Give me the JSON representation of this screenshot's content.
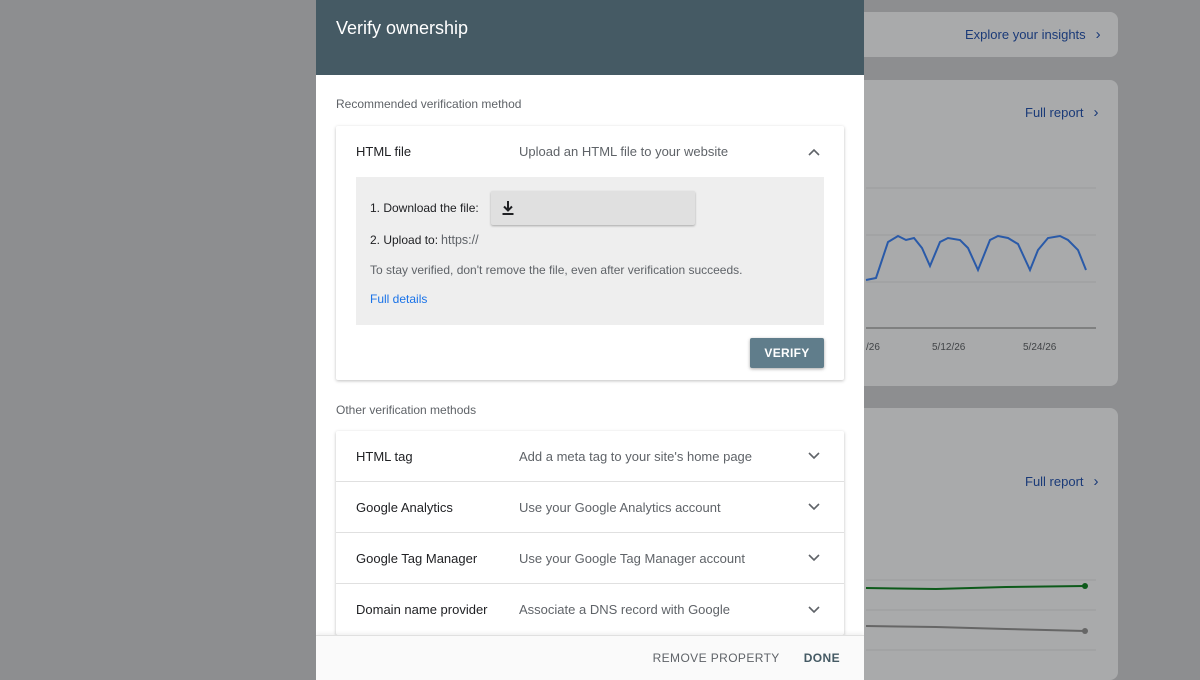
{
  "background": {
    "explore_link": "Explore your insights",
    "full_report_1": "Full report",
    "full_report_2": "Full report",
    "chart_ticks": [
      "/26",
      "5/12/26",
      "5/24/26"
    ],
    "colors": {
      "line_blue": "#2a5aa8",
      "line_green": "#0d5a1a",
      "line_gray": "#666666"
    }
  },
  "dialog": {
    "title": "Verify ownership",
    "recommended_label": "Recommended verification method",
    "recommended": {
      "name": "HTML file",
      "description": "Upload an HTML file to your website",
      "step1_label": "1. Download the file:",
      "step2_label": "2. Upload to:",
      "step2_url": "https://",
      "note": "To stay verified, don't remove the file, even after verification succeeds.",
      "details_link": "Full details",
      "verify_label": "VERIFY",
      "icons": {
        "download": "download-icon",
        "collapse": "chevron-up-icon"
      }
    },
    "other_label": "Other verification methods",
    "other_methods": [
      {
        "name": "HTML tag",
        "description": "Add a meta tag to your site's home page"
      },
      {
        "name": "Google Analytics",
        "description": "Use your Google Analytics account"
      },
      {
        "name": "Google Tag Manager",
        "description": "Use your Google Tag Manager account"
      },
      {
        "name": "Domain name provider",
        "description": "Associate a DNS record with Google"
      }
    ],
    "footer": {
      "remove_label": "REMOVE PROPERTY",
      "done_label": "DONE"
    },
    "colors": {
      "header_bg": "#455a64",
      "verify_bg": "#607d8b",
      "link": "#1a73e8"
    }
  }
}
